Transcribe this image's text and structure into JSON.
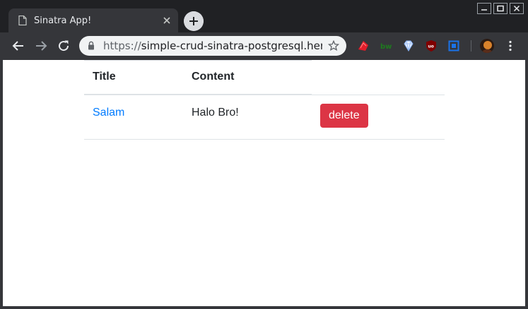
{
  "browser": {
    "tab": {
      "title": "Sinatra App!"
    },
    "address": {
      "scheme": "https://",
      "rest": "simple-crud-sinatra-postgresql.her..."
    },
    "extensions": [
      {
        "name": "ruby-extension-icon",
        "color": "#e11d2a"
      },
      {
        "name": "bw-extension-icon",
        "color": "#1e7a1e"
      },
      {
        "name": "diamond-extension-icon",
        "color": "#8ab4f8"
      },
      {
        "name": "ublock-extension-icon",
        "color": "#800000"
      },
      {
        "name": "square-extension-icon",
        "color": "#1a73e8"
      }
    ]
  },
  "page": {
    "table": {
      "headers": [
        "Title",
        "Content",
        ""
      ],
      "rows": [
        {
          "title": "Salam",
          "content": "Halo Bro!",
          "action": "delete"
        }
      ]
    }
  },
  "colors": {
    "link": "#007bff",
    "danger": "#dc3545",
    "chrome_dark": "#202124",
    "chrome_toolbar": "#35363a"
  }
}
